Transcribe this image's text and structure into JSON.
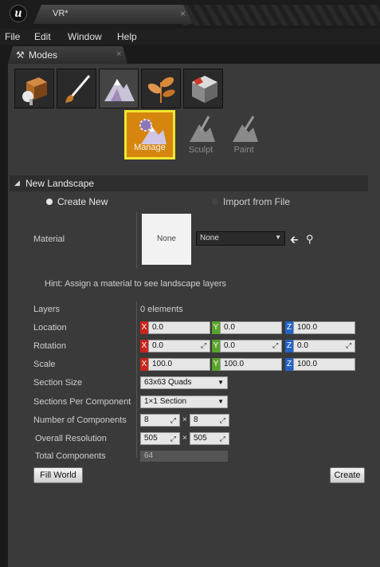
{
  "window": {
    "tab_title": "VR*",
    "close": "×"
  },
  "menu": [
    "File",
    "Edit",
    "Window",
    "Help"
  ],
  "modes_panel": {
    "tab_label": "Modes",
    "close": "×"
  },
  "mode_buttons": [
    {
      "name": "place-mode",
      "icon": "cube-sphere-icon"
    },
    {
      "name": "paint-mode",
      "icon": "brush-icon"
    },
    {
      "name": "landscape-mode",
      "icon": "mountain-icon",
      "active": true
    },
    {
      "name": "foliage-mode",
      "icon": "leaf-icon"
    },
    {
      "name": "geometry-mode",
      "icon": "geometry-box-icon"
    }
  ],
  "tools": {
    "manage": "Manage",
    "sculpt": "Sculpt",
    "paint": "Paint"
  },
  "section": {
    "title": "New Landscape"
  },
  "source": {
    "create_new": "Create New",
    "import_file": "Import from File",
    "selected": "create_new"
  },
  "material": {
    "label": "Material",
    "thumb_text": "None",
    "combo_value": "None"
  },
  "hint": "Hint: Assign a material to see landscape layers",
  "layers": {
    "label": "Layers",
    "value": "0 elements"
  },
  "location": {
    "label": "Location",
    "x": "0.0",
    "y": "0.0",
    "z": "100.0"
  },
  "rotation": {
    "label": "Rotation",
    "x": "0.0",
    "y": "0.0",
    "z": "0.0"
  },
  "scale": {
    "label": "Scale",
    "x": "100.0",
    "y": "100.0",
    "z": "100.0"
  },
  "axis": {
    "x": "X",
    "y": "Y",
    "z": "Z"
  },
  "section_size": {
    "label": "Section Size",
    "value": "63x63 Quads"
  },
  "sections_per_component": {
    "label": "Sections Per Component",
    "value": "1×1 Section"
  },
  "num_components": {
    "label": "Number of Components",
    "x": "8",
    "y": "8",
    "times": "×"
  },
  "overall_resolution": {
    "label": "Overall Resolution",
    "x": "505",
    "y": "505",
    "times": "×"
  },
  "total_components": {
    "label": "Total Components",
    "value": "64"
  },
  "buttons": {
    "fill_world": "Fill World",
    "create": "Create"
  },
  "colors": {
    "accent": "#d6860f",
    "highlight": "#f0e630",
    "axis_x": "#c8251b",
    "axis_y": "#59a32a",
    "axis_z": "#2363c6"
  }
}
